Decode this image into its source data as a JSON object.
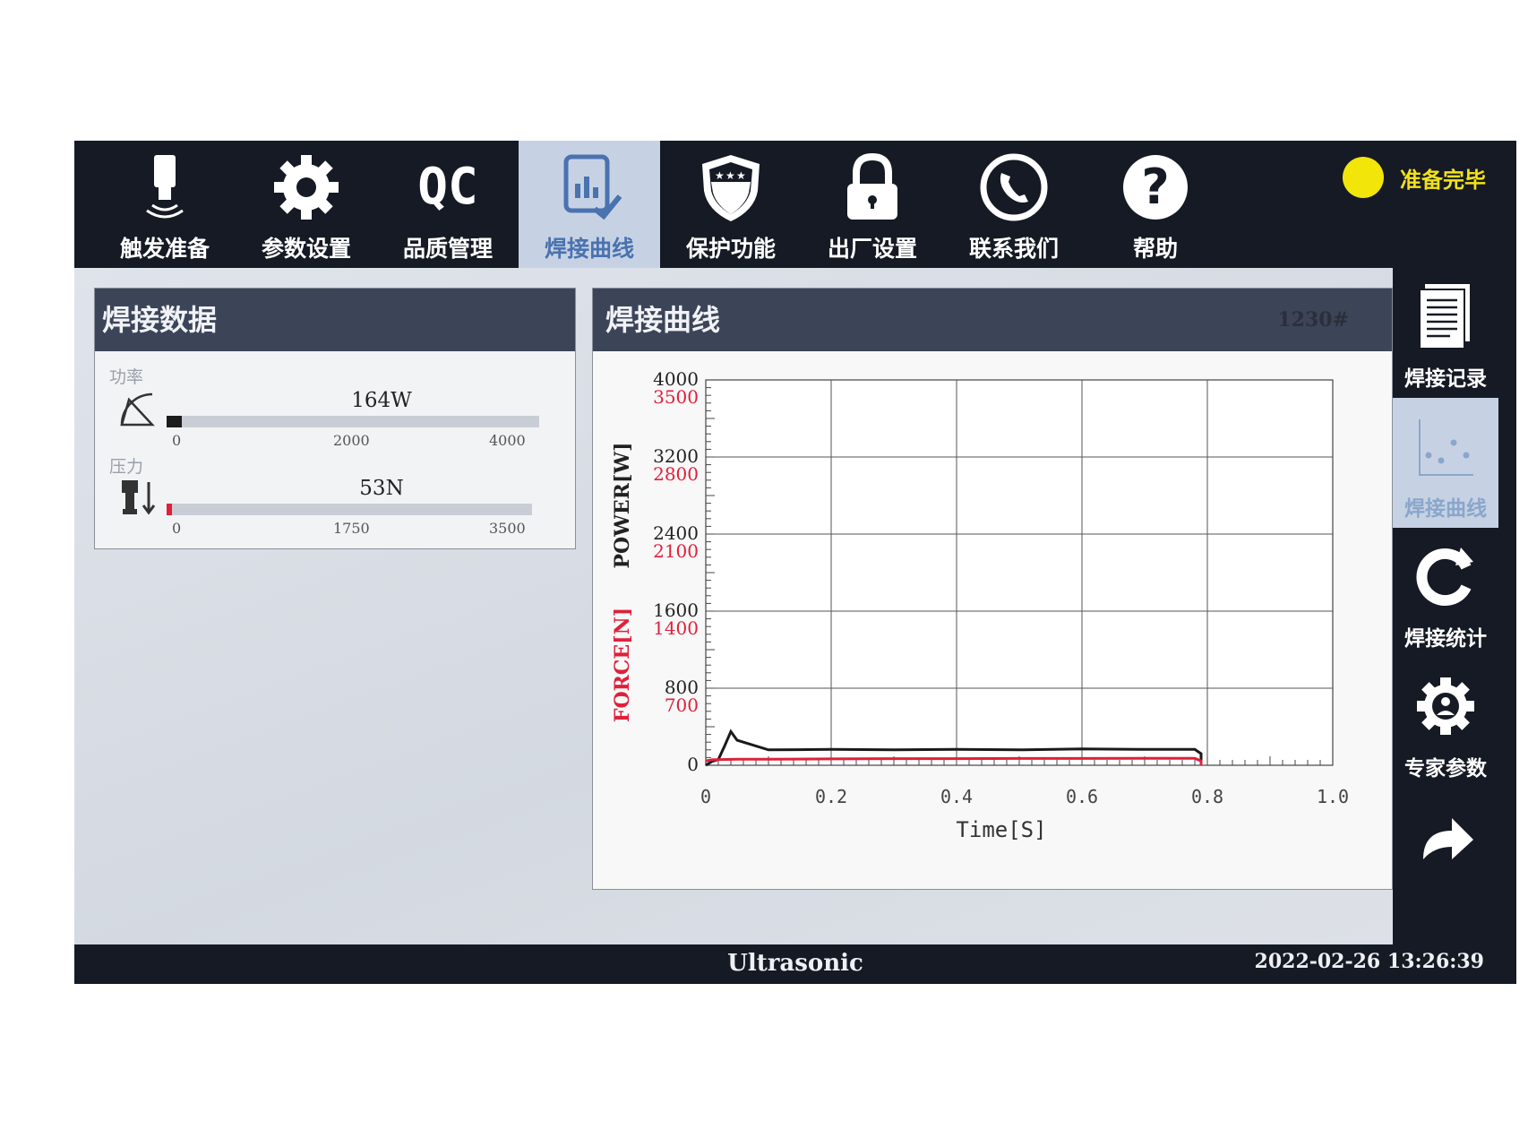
{
  "nav": {
    "items": [
      {
        "label": "触发准备",
        "icon": "horn-trigger-icon"
      },
      {
        "label": "参数设置",
        "icon": "gear-icon"
      },
      {
        "label": "品质管理",
        "icon": "qc-icon"
      },
      {
        "label": "焊接曲线",
        "icon": "chart-check-icon"
      },
      {
        "label": "保护功能",
        "icon": "shield-stars-icon"
      },
      {
        "label": "出厂设置",
        "icon": "lock-icon"
      },
      {
        "label": "联系我们",
        "icon": "phone-icon"
      },
      {
        "label": "帮助",
        "icon": "help-icon"
      }
    ],
    "active": "焊接曲线",
    "qc_text": "QC"
  },
  "status": {
    "text": "准备完毕",
    "color": "#f2e50a"
  },
  "data_panel": {
    "title": "焊接数据",
    "power": {
      "label": "功率",
      "value": "164W",
      "fraction": 0.041,
      "ticks": [
        "0",
        "2000",
        "4000"
      ]
    },
    "force": {
      "label": "压力",
      "value": "53N",
      "fraction": 0.015,
      "ticks": [
        "0",
        "1750",
        "3500"
      ]
    }
  },
  "curve_panel": {
    "title": "焊接曲线",
    "count": "1230#"
  },
  "chart_data": {
    "type": "line",
    "xlabel": "Time[S]",
    "ylabel_power": "POWER[W]",
    "ylabel_force": "FORCE[N]",
    "x_ticks": [
      "0",
      "0.2",
      "0.4",
      "0.6",
      "0.8",
      "1.0"
    ],
    "xlim": [
      0,
      1.0
    ],
    "power_ticks": [
      "4000",
      "3200",
      "2400",
      "1600",
      "800",
      "0"
    ],
    "force_ticks": [
      "3500",
      "2800",
      "2100",
      "1400",
      "700"
    ],
    "power_ylim": [
      0,
      4000
    ],
    "force_ylim": [
      0,
      3500
    ],
    "grid": true,
    "series": [
      {
        "name": "POWER[W]",
        "axis": "power",
        "color": "#1a1a1a",
        "x": [
          0,
          0.01,
          0.02,
          0.03,
          0.04,
          0.05,
          0.1,
          0.2,
          0.3,
          0.4,
          0.5,
          0.6,
          0.7,
          0.78,
          0.79,
          0.79
        ],
        "y": [
          0,
          40,
          60,
          200,
          350,
          260,
          160,
          165,
          160,
          165,
          160,
          170,
          165,
          165,
          120,
          0
        ]
      },
      {
        "name": "FORCE[N]",
        "axis": "force",
        "color": "#e0203a",
        "x": [
          0,
          0.01,
          0.05,
          0.1,
          0.2,
          0.3,
          0.4,
          0.5,
          0.6,
          0.7,
          0.78,
          0.79,
          0.79
        ],
        "y": [
          40,
          50,
          55,
          55,
          58,
          60,
          60,
          62,
          62,
          63,
          63,
          40,
          0
        ]
      }
    ]
  },
  "sidebar": {
    "items": [
      {
        "label": "焊接记录",
        "icon": "document-icon"
      },
      {
        "label": "焊接曲线",
        "icon": "scatter-chart-icon"
      },
      {
        "label": "焊接统计",
        "icon": "refresh-stats-icon"
      },
      {
        "label": "专家参数",
        "icon": "expert-gear-icon"
      },
      {
        "label": "",
        "icon": "forward-arrow-icon"
      }
    ]
  },
  "footer": {
    "brand": "Ultrasonic",
    "datetime": "2022-02-26  13:26:39"
  }
}
